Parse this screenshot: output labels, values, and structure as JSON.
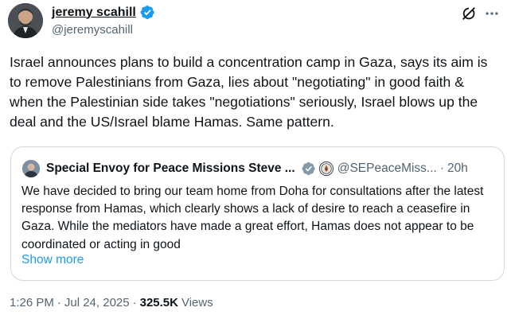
{
  "author": {
    "name": "jeremy scahill",
    "handle": "@jeremyscahill",
    "verified_color": "#1d9bf0"
  },
  "tweet": {
    "text": "Israel announces plans to build a concentration camp in Gaza, says its aim is to remove Palestinians from Gaza, lies about \"negotiating\" in good faith & when the Palestinian side takes \"negotiations\" seriously, Israel blows up the deal and the US/Israel blame Hamas. Same pattern."
  },
  "quote": {
    "name": "Special Envoy for Peace Missions Steve ...",
    "handle": "@SEPeaceMiss...",
    "separator": "·",
    "time": "20h",
    "verified_color": "#829aab",
    "text": "We have decided to bring our team home from Doha for consultations after the latest response from Hamas, which clearly shows a lack of desire to reach a ceasefire in Gaza. While the mediators have made a great effort, Hamas does not appear to be coordinated or acting in good",
    "show_more": "Show more"
  },
  "meta": {
    "time": "1:26 PM",
    "date": "Jul 24, 2025",
    "separator": "·",
    "views_count": "325.5K",
    "views_label": "Views"
  },
  "icons": {
    "grok": "grok-icon",
    "more": "more-options-icon"
  }
}
